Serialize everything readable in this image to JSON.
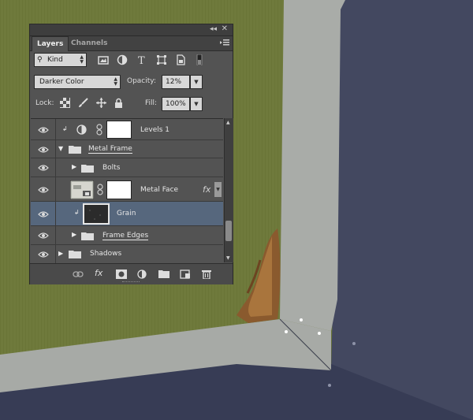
{
  "panel": {
    "tabs": [
      "Layers",
      "Channels"
    ],
    "panel_controls": {
      "collapse": "◂◂",
      "close": "✕"
    },
    "filter": {
      "kind_label": "Kind",
      "icons": [
        "image-filter-icon",
        "adjustment-filter-icon",
        "type-filter-icon",
        "shape-filter-icon",
        "smart-object-filter-icon",
        "filter-toggle-icon"
      ]
    },
    "blend_mode": "Darker Color",
    "opacity_label": "Opacity:",
    "opacity_value": "12%",
    "lock_label": "Lock:",
    "fill_label": "Fill:",
    "fill_value": "100%",
    "layers": [
      {
        "name": "Levels 1",
        "type": "adjustment",
        "clipped": true
      },
      {
        "name": "Metal Frame",
        "type": "group",
        "expanded": true
      },
      {
        "name": "Bolts",
        "type": "group",
        "expanded": false
      },
      {
        "name": "Metal Face",
        "type": "layer",
        "has_mask": true,
        "fx": "fx"
      },
      {
        "name": "Grain",
        "type": "layer",
        "clipped": true,
        "selected": true
      },
      {
        "name": "Frame Edges",
        "type": "group",
        "expanded": false
      },
      {
        "name": "Shadows",
        "type": "group",
        "expanded": false
      }
    ],
    "bottom_icons": [
      "link-layers-icon",
      "fx-icon",
      "add-mask-icon",
      "new-adjustment-icon",
      "new-group-icon",
      "new-layer-icon",
      "delete-layer-icon"
    ],
    "fx_label": "fx"
  },
  "colors": {
    "panel_bg": "#535353",
    "selected_row": "#56677d",
    "canvas_green": "#6f7a3c",
    "frame_gray": "#a9aca8",
    "dark_navy": "#424761"
  }
}
